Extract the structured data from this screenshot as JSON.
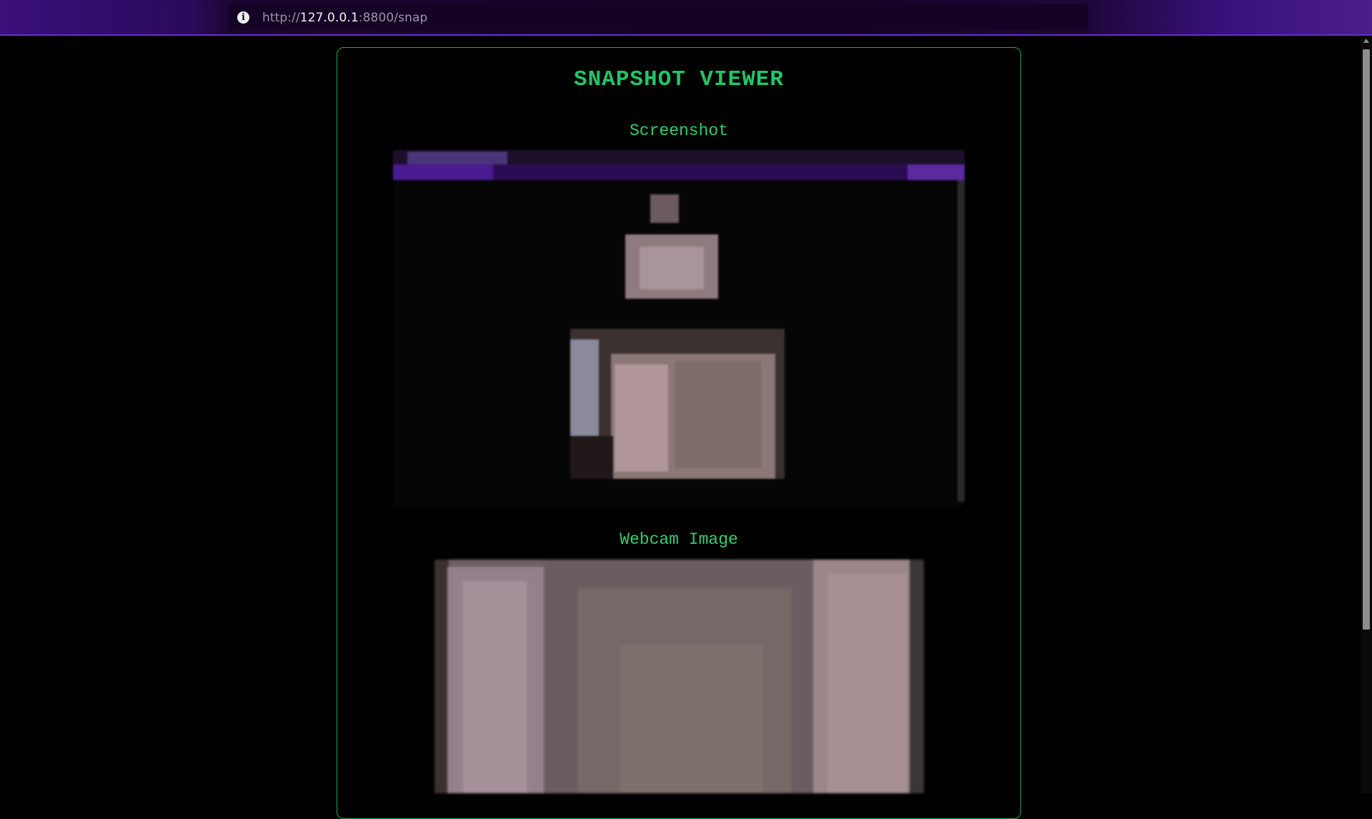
{
  "browser": {
    "url_scheme": "http://",
    "url_host": "127.0.0.1",
    "url_rest": ":8800/snap",
    "info_icon": "info-icon"
  },
  "page": {
    "title": "SNAPSHOT VIEWER",
    "screenshot_label": "Screenshot",
    "webcam_label": "Webcam Image"
  },
  "colors": {
    "accent_green": "#22c563",
    "panel_border": "#1faa55",
    "browser_purple": "#3a0f7a",
    "background": "#000000"
  }
}
